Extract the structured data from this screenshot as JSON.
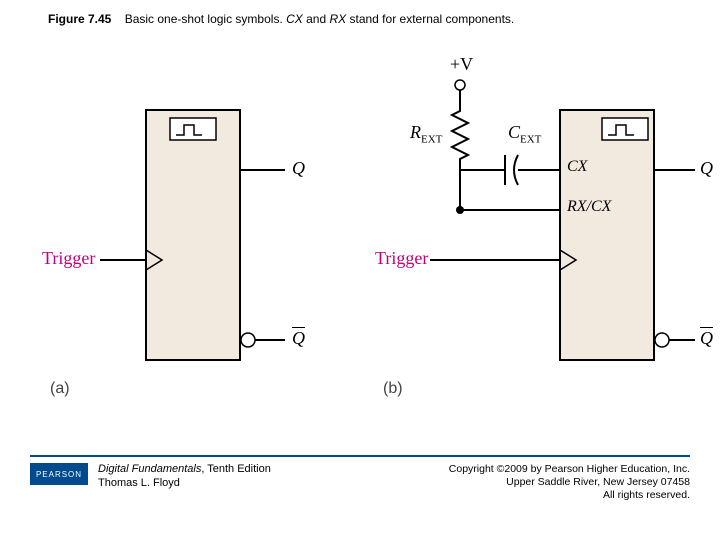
{
  "caption": {
    "prefix": "Figure 7.45",
    "text_before_cx": "Basic one-shot logic symbols. ",
    "cx": "CX",
    "mid": " and ",
    "rx": "RX",
    "text_after": " stand for external components."
  },
  "labels": {
    "trigger": "Trigger",
    "Q": "Q",
    "Qbar": "Q",
    "CX": "CX",
    "RXCX": "RX/CX",
    "plusV": "+V",
    "Rext": "R",
    "Rext_sub": "EXT",
    "Cext": "C",
    "Cext_sub": "EXT"
  },
  "parts": {
    "a": "(a)",
    "b": "(b)"
  },
  "footer": {
    "logo": "PEARSON",
    "book_title": "Digital Fundamentals",
    "edition": ", Tenth Edition",
    "author": "Thomas L. Floyd",
    "copyright1": "Copyright ©2009 by Pearson Higher Education, Inc.",
    "copyright2": "Upper Saddle River, New Jersey 07458",
    "copyright3": "All rights reserved."
  }
}
